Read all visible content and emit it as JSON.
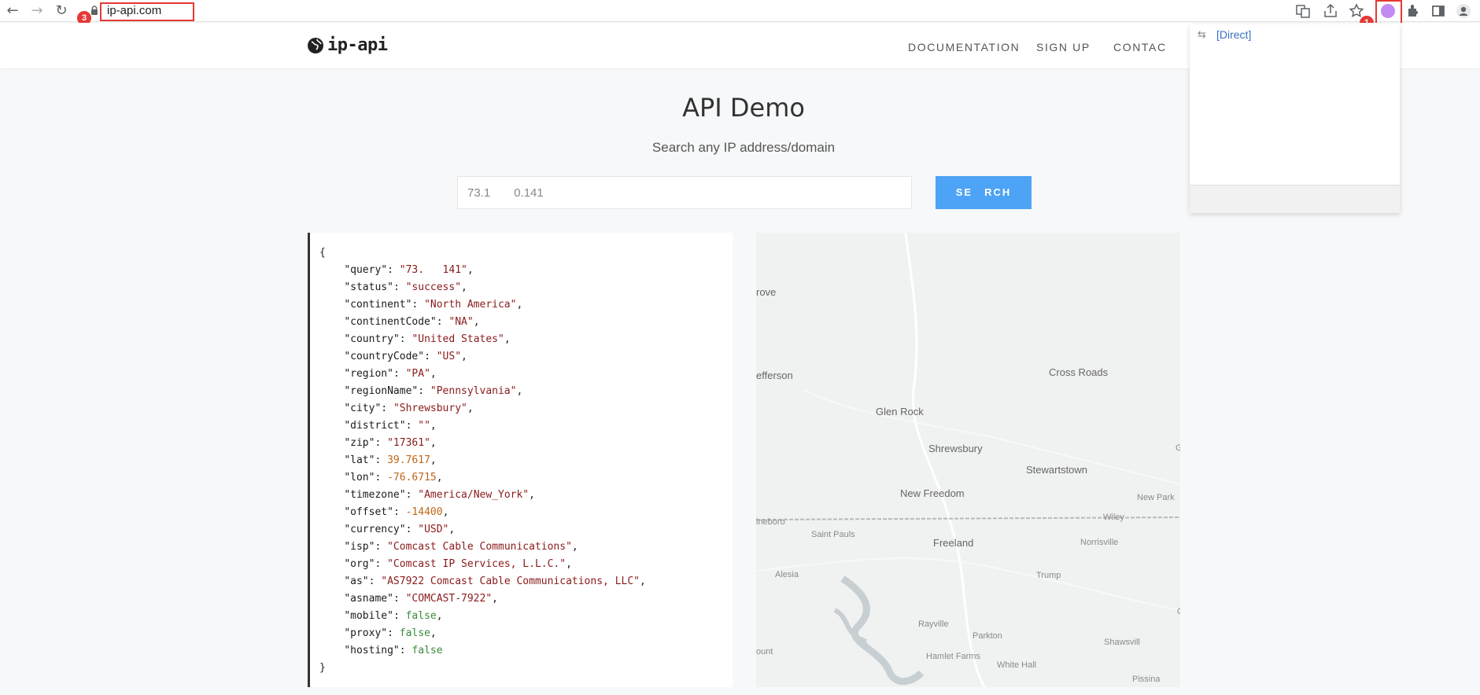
{
  "browser": {
    "url": "ip-api.com",
    "badges": [
      "1",
      "3"
    ]
  },
  "site": {
    "logo_text": "ip-api",
    "nav": [
      "DOCUMENTATION",
      "SIGN UP",
      "CONTAC"
    ]
  },
  "main": {
    "title": "API Demo",
    "subtitle": "Search any IP address/domain",
    "input_value": "73.1  0.141",
    "search_label": "SE RCH"
  },
  "json_open": "{",
  "json_close": "}",
  "json_lines": [
    {
      "key": "\"query\"",
      "val": "\"73.   141\"",
      "type": "s"
    },
    {
      "key": "\"status\"",
      "val": "\"success\"",
      "type": "s"
    },
    {
      "key": "\"continent\"",
      "val": "\"North America\"",
      "type": "s"
    },
    {
      "key": "\"continentCode\"",
      "val": "\"NA\"",
      "type": "s"
    },
    {
      "key": "\"country\"",
      "val": "\"United States\"",
      "type": "s"
    },
    {
      "key": "\"countryCode\"",
      "val": "\"US\"",
      "type": "s"
    },
    {
      "key": "\"region\"",
      "val": "\"PA\"",
      "type": "s"
    },
    {
      "key": "\"regionName\"",
      "val": "\"Pennsylvania\"",
      "type": "s"
    },
    {
      "key": "\"city\"",
      "val": "\"Shrewsbury\"",
      "type": "s"
    },
    {
      "key": "\"district\"",
      "val": "\"\"",
      "type": "s"
    },
    {
      "key": "\"zip\"",
      "val": "\"17361\"",
      "type": "s"
    },
    {
      "key": "\"lat\"",
      "val": "39.7617",
      "type": "n"
    },
    {
      "key": "\"lon\"",
      "val": "-76.6715",
      "type": "n"
    },
    {
      "key": "\"timezone\"",
      "val": "\"America/New_York\"",
      "type": "s"
    },
    {
      "key": "\"offset\"",
      "val": "-14400",
      "type": "n"
    },
    {
      "key": "\"currency\"",
      "val": "\"USD\"",
      "type": "s"
    },
    {
      "key": "\"isp\"",
      "val": "\"Comcast Cable Communications\"",
      "type": "s"
    },
    {
      "key": "\"org\"",
      "val": "\"Comcast IP Services, L.L.C.\"",
      "type": "s"
    },
    {
      "key": "\"as\"",
      "val": "\"AS7922 Comcast Cable Communications, LLC\"",
      "type": "s"
    },
    {
      "key": "\"asname\"",
      "val": "\"COMCAST-7922\"",
      "type": "s"
    },
    {
      "key": "\"mobile\"",
      "val": "false",
      "type": "b"
    },
    {
      "key": "\"proxy\"",
      "val": "false",
      "type": "b"
    },
    {
      "key": "\"hosting\"",
      "val": "false",
      "type": "b",
      "last": true
    }
  ],
  "map_labels": [
    "rove",
    "efferson",
    "Cross Roads",
    "Glen Rock",
    "Shrewsbury",
    "Stewartstown",
    "New Freedom",
    "New Park",
    "Wiley",
    "ineboro",
    "Saint Pauls",
    "Freeland",
    "Norrisville",
    "Alesia",
    "Trump",
    "Rayville",
    "Parkton",
    "Shawsvill",
    "Hamlet Farms",
    "ount",
    "White Hall",
    "Pissina",
    "G",
    "C"
  ],
  "dropdown": {
    "item": "[Direct]"
  }
}
